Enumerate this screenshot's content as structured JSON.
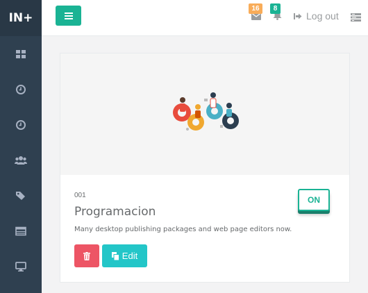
{
  "sidebar": {
    "logo": "IN+",
    "items": [
      {
        "icon": "dashboard-icon"
      },
      {
        "icon": "clock-icon"
      },
      {
        "icon": "clock-icon"
      },
      {
        "icon": "users-icon"
      },
      {
        "icon": "tags-icon"
      },
      {
        "icon": "table-icon"
      },
      {
        "icon": "monitor-icon"
      }
    ]
  },
  "topbar": {
    "menu_icon": "hamburger-icon",
    "messages_count": "16",
    "notifications_count": "8",
    "logout_label": "Log out"
  },
  "card": {
    "id": "001",
    "title": "Programacion",
    "description": "Many desktop publishing packages and web page editors now.",
    "toggle_label": "ON",
    "edit_label": "Edit"
  },
  "colors": {
    "sidebar": "#2f4050",
    "primary": "#1ab394",
    "danger": "#ed5565",
    "info": "#23c6c8",
    "warning": "#f8ac59"
  }
}
